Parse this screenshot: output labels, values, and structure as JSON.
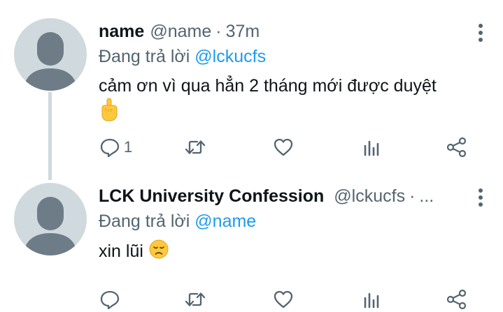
{
  "tweets": [
    {
      "display_name": "name",
      "handle": "@name",
      "separator": "·",
      "time": "37m",
      "reply_prefix": "Đang trả lời",
      "reply_to": "@lckucfs",
      "text": "cảm ơn vì qua hẳn 2 tháng mới được duyệt",
      "emoji": "middle-finger",
      "reply_count": "1"
    },
    {
      "display_name": "LCK University Confession",
      "handle": "@lckucfs",
      "separator": "·",
      "truncation": "...",
      "reply_prefix": "Đang trả lời",
      "reply_to": "@name",
      "text": "xin lũi",
      "emoji": "disappointed-face"
    }
  ],
  "colors": {
    "accent": "#1d9bf0",
    "secondary_text": "#536471",
    "avatar_bg": "#cfd9de",
    "avatar_fg": "#6e7c87"
  }
}
